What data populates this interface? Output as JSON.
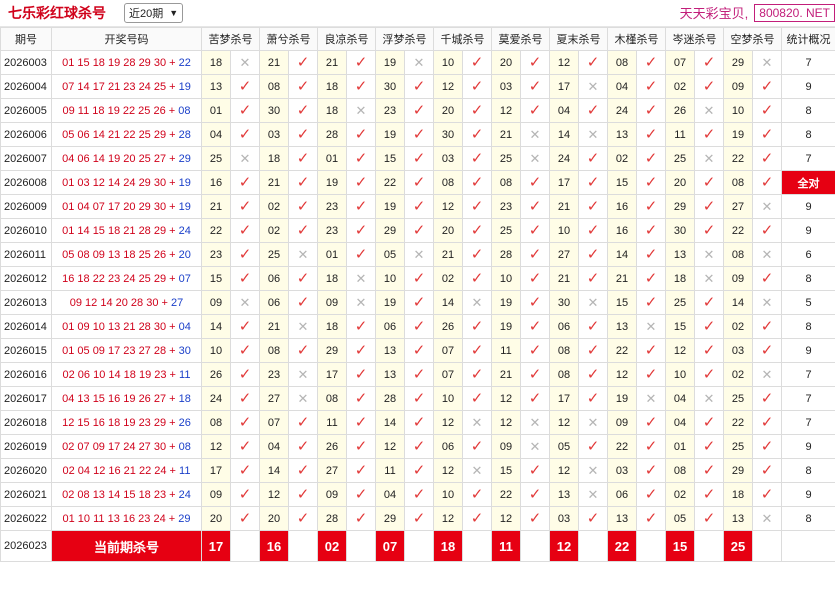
{
  "header": {
    "title": "七乐彩红球杀号",
    "period_select": "近20期",
    "brand_text": "天天彩宝贝,",
    "brand_box": "800820. NET"
  },
  "columns": [
    "期号",
    "开奖号码",
    "苦梦杀号",
    "萧兮杀号",
    "良凉杀号",
    "浮梦杀号",
    "千城杀号",
    "莫爱杀号",
    "夏末杀号",
    "木槿杀号",
    "岑迷杀号",
    "空梦杀号",
    "统计概况"
  ],
  "rows": [
    {
      "issue": "2026003",
      "reds": "01 15 18 19 28 29 30 +",
      "blue": "22",
      "kills": [
        [
          "18",
          false
        ],
        [
          "21",
          true
        ],
        [
          "21",
          true
        ],
        [
          "19",
          false
        ],
        [
          "10",
          true
        ],
        [
          "20",
          true
        ],
        [
          "12",
          true
        ],
        [
          "08",
          true
        ],
        [
          "07",
          true
        ],
        [
          "29",
          false
        ]
      ],
      "stat": "7",
      "full": false
    },
    {
      "issue": "2026004",
      "reds": "07 14 17 21 23 24 25 +",
      "blue": "19",
      "kills": [
        [
          "13",
          true
        ],
        [
          "08",
          true
        ],
        [
          "18",
          true
        ],
        [
          "30",
          true
        ],
        [
          "12",
          true
        ],
        [
          "03",
          true
        ],
        [
          "17",
          false
        ],
        [
          "04",
          true
        ],
        [
          "02",
          true
        ],
        [
          "09",
          true
        ]
      ],
      "stat": "9",
      "full": false
    },
    {
      "issue": "2026005",
      "reds": "09 11 18 19 22 25 26 +",
      "blue": "08",
      "kills": [
        [
          "01",
          true
        ],
        [
          "30",
          true
        ],
        [
          "18",
          false
        ],
        [
          "23",
          true
        ],
        [
          "20",
          true
        ],
        [
          "12",
          true
        ],
        [
          "04",
          true
        ],
        [
          "24",
          true
        ],
        [
          "26",
          false
        ],
        [
          "10",
          true
        ]
      ],
      "stat": "8",
      "full": false
    },
    {
      "issue": "2026006",
      "reds": "05 06 14 21 22 25 29 +",
      "blue": "28",
      "kills": [
        [
          "04",
          true
        ],
        [
          "03",
          true
        ],
        [
          "28",
          true
        ],
        [
          "19",
          true
        ],
        [
          "30",
          true
        ],
        [
          "21",
          false
        ],
        [
          "14",
          false
        ],
        [
          "13",
          true
        ],
        [
          "11",
          true
        ],
        [
          "19",
          true
        ]
      ],
      "stat": "8",
      "full": false
    },
    {
      "issue": "2026007",
      "reds": "04 06 14 19 20 25 27 +",
      "blue": "29",
      "kills": [
        [
          "25",
          false
        ],
        [
          "18",
          true
        ],
        [
          "01",
          true
        ],
        [
          "15",
          true
        ],
        [
          "03",
          true
        ],
        [
          "25",
          false
        ],
        [
          "24",
          true
        ],
        [
          "02",
          true
        ],
        [
          "25",
          false
        ],
        [
          "22",
          true
        ]
      ],
      "stat": "7",
      "full": false
    },
    {
      "issue": "2026008",
      "reds": "01 03 12 14 24 29 30 +",
      "blue": "19",
      "kills": [
        [
          "16",
          true
        ],
        [
          "21",
          true
        ],
        [
          "19",
          true
        ],
        [
          "22",
          true
        ],
        [
          "08",
          true
        ],
        [
          "08",
          true
        ],
        [
          "17",
          true
        ],
        [
          "15",
          true
        ],
        [
          "20",
          true
        ],
        [
          "08",
          true
        ]
      ],
      "stat": "全对",
      "full": true
    },
    {
      "issue": "2026009",
      "reds": "01 04 07 17 20 29 30 +",
      "blue": "19",
      "kills": [
        [
          "21",
          true
        ],
        [
          "02",
          true
        ],
        [
          "23",
          true
        ],
        [
          "19",
          true
        ],
        [
          "12",
          true
        ],
        [
          "23",
          true
        ],
        [
          "21",
          true
        ],
        [
          "16",
          true
        ],
        [
          "29",
          true
        ],
        [
          "27",
          false
        ]
      ],
      "stat": "9",
      "full": false
    },
    {
      "issue": "2026010",
      "reds": "01 14 15 18 21 28 29 +",
      "blue": "24",
      "kills": [
        [
          "22",
          true
        ],
        [
          "02",
          true
        ],
        [
          "23",
          true
        ],
        [
          "29",
          true
        ],
        [
          "20",
          true
        ],
        [
          "25",
          true
        ],
        [
          "10",
          true
        ],
        [
          "16",
          true
        ],
        [
          "30",
          true
        ],
        [
          "22",
          true
        ]
      ],
      "stat": "9",
      "full": false
    },
    {
      "issue": "2026011",
      "reds": "05 08 09 13 18 25 26 +",
      "blue": "20",
      "kills": [
        [
          "23",
          true
        ],
        [
          "25",
          false
        ],
        [
          "01",
          true
        ],
        [
          "05",
          false
        ],
        [
          "21",
          true
        ],
        [
          "28",
          true
        ],
        [
          "27",
          true
        ],
        [
          "14",
          true
        ],
        [
          "13",
          false
        ],
        [
          "08",
          false
        ]
      ],
      "stat": "6",
      "full": false
    },
    {
      "issue": "2026012",
      "reds": "16 18 22 23 24 25 29 +",
      "blue": "07",
      "kills": [
        [
          "15",
          true
        ],
        [
          "06",
          true
        ],
        [
          "18",
          false
        ],
        [
          "10",
          true
        ],
        [
          "02",
          true
        ],
        [
          "10",
          true
        ],
        [
          "21",
          true
        ],
        [
          "21",
          true
        ],
        [
          "18",
          false
        ],
        [
          "09",
          true
        ]
      ],
      "stat": "8",
      "full": false
    },
    {
      "issue": "2026013",
      "reds": "09 12 14 20 28 30 +",
      "blue": "27",
      "kills": [
        [
          "09",
          false
        ],
        [
          "06",
          true
        ],
        [
          "09",
          false
        ],
        [
          "19",
          true
        ],
        [
          "14",
          false
        ],
        [
          "19",
          true
        ],
        [
          "30",
          false
        ],
        [
          "15",
          true
        ],
        [
          "25",
          true
        ],
        [
          "14",
          false
        ]
      ],
      "stat": "5",
      "full": false
    },
    {
      "issue": "2026014",
      "reds": "01 09 10 13 21 28 30 +",
      "blue": "04",
      "kills": [
        [
          "14",
          true
        ],
        [
          "21",
          false
        ],
        [
          "18",
          true
        ],
        [
          "06",
          true
        ],
        [
          "26",
          true
        ],
        [
          "19",
          true
        ],
        [
          "06",
          true
        ],
        [
          "13",
          false
        ],
        [
          "15",
          true
        ],
        [
          "02",
          true
        ]
      ],
      "stat": "8",
      "full": false
    },
    {
      "issue": "2026015",
      "reds": "01 05 09 17 23 27 28 +",
      "blue": "30",
      "kills": [
        [
          "10",
          true
        ],
        [
          "08",
          true
        ],
        [
          "29",
          true
        ],
        [
          "13",
          true
        ],
        [
          "07",
          true
        ],
        [
          "11",
          true
        ],
        [
          "08",
          true
        ],
        [
          "22",
          true
        ],
        [
          "12",
          true
        ],
        [
          "03",
          true
        ]
      ],
      "stat": "9",
      "full": false
    },
    {
      "issue": "2026016",
      "reds": "02 06 10 14 18 19 23 +",
      "blue": "11",
      "kills": [
        [
          "26",
          true
        ],
        [
          "23",
          false
        ],
        [
          "17",
          true
        ],
        [
          "13",
          true
        ],
        [
          "07",
          true
        ],
        [
          "21",
          true
        ],
        [
          "08",
          true
        ],
        [
          "12",
          true
        ],
        [
          "10",
          true
        ],
        [
          "02",
          false
        ]
      ],
      "stat": "7",
      "full": false
    },
    {
      "issue": "2026017",
      "reds": "04 13 15 16 19 26 27 +",
      "blue": "18",
      "kills": [
        [
          "24",
          true
        ],
        [
          "27",
          false
        ],
        [
          "08",
          true
        ],
        [
          "28",
          true
        ],
        [
          "10",
          true
        ],
        [
          "12",
          true
        ],
        [
          "17",
          true
        ],
        [
          "19",
          false
        ],
        [
          "04",
          false
        ],
        [
          "25",
          true
        ]
      ],
      "stat": "7",
      "full": false
    },
    {
      "issue": "2026018",
      "reds": "12 15 16 18 19 23 29 +",
      "blue": "26",
      "kills": [
        [
          "08",
          true
        ],
        [
          "07",
          true
        ],
        [
          "11",
          true
        ],
        [
          "14",
          true
        ],
        [
          "12",
          false
        ],
        [
          "12",
          false
        ],
        [
          "12",
          false
        ],
        [
          "09",
          true
        ],
        [
          "04",
          true
        ],
        [
          "22",
          true
        ]
      ],
      "stat": "7",
      "full": false
    },
    {
      "issue": "2026019",
      "reds": "02 07 09 17 24 27 30 +",
      "blue": "08",
      "kills": [
        [
          "12",
          true
        ],
        [
          "04",
          true
        ],
        [
          "26",
          true
        ],
        [
          "12",
          true
        ],
        [
          "06",
          true
        ],
        [
          "09",
          false
        ],
        [
          "05",
          true
        ],
        [
          "22",
          true
        ],
        [
          "01",
          true
        ],
        [
          "25",
          true
        ]
      ],
      "stat": "9",
      "full": false
    },
    {
      "issue": "2026020",
      "reds": "02 04 12 16 21 22 24 +",
      "blue": "11",
      "kills": [
        [
          "17",
          true
        ],
        [
          "14",
          true
        ],
        [
          "27",
          true
        ],
        [
          "11",
          true
        ],
        [
          "12",
          false
        ],
        [
          "15",
          true
        ],
        [
          "12",
          false
        ],
        [
          "03",
          true
        ],
        [
          "08",
          true
        ],
        [
          "29",
          true
        ]
      ],
      "stat": "8",
      "full": false
    },
    {
      "issue": "2026021",
      "reds": "02 08 13 14 15 18 23 +",
      "blue": "24",
      "kills": [
        [
          "09",
          true
        ],
        [
          "12",
          true
        ],
        [
          "09",
          true
        ],
        [
          "04",
          true
        ],
        [
          "10",
          true
        ],
        [
          "22",
          true
        ],
        [
          "13",
          false
        ],
        [
          "06",
          true
        ],
        [
          "02",
          true
        ],
        [
          "18",
          true
        ]
      ],
      "stat": "9",
      "full": false
    },
    {
      "issue": "2026022",
      "reds": "01 10 11 13 16 23 24 +",
      "blue": "29",
      "kills": [
        [
          "20",
          true
        ],
        [
          "20",
          true
        ],
        [
          "28",
          true
        ],
        [
          "29",
          true
        ],
        [
          "12",
          true
        ],
        [
          "12",
          true
        ],
        [
          "03",
          true
        ],
        [
          "13",
          true
        ],
        [
          "05",
          true
        ],
        [
          "13",
          false
        ]
      ],
      "stat": "8",
      "full": false
    }
  ],
  "prediction": {
    "issue": "2026023",
    "label": "当前期杀号",
    "kills": [
      "17",
      "16",
      "02",
      "07",
      "18",
      "11",
      "12",
      "22",
      "15",
      "25"
    ]
  },
  "icons": {
    "check": "check-icon",
    "cross": "cross-icon"
  },
  "colors": {
    "red": "#e60012",
    "title_red": "#d0021b",
    "blue_ball": "#1a3fc9",
    "brand": "#c21e7a",
    "kill_bg": "#fffde7"
  }
}
